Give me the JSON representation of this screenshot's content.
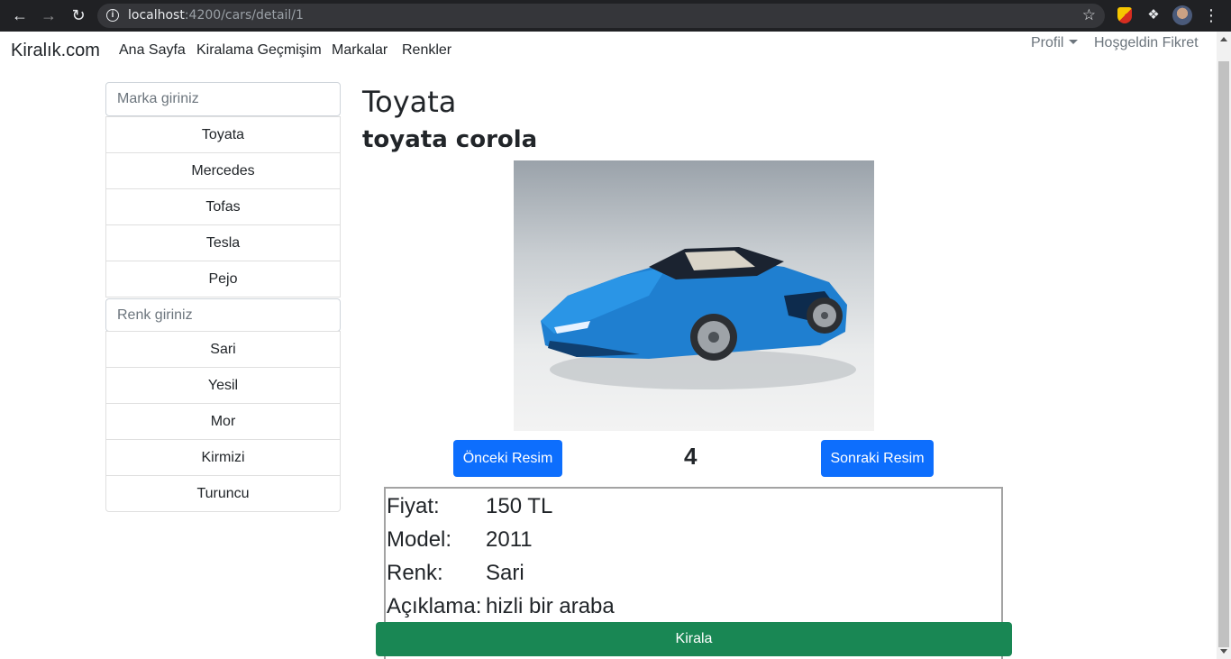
{
  "browser": {
    "url_host": "localhost",
    "url_path": ":4200/cars/detail/1"
  },
  "navbar": {
    "brand": "Kiralık.com",
    "links": [
      "Ana Sayfa",
      "Kiralama Geçmişim",
      "Markalar",
      "Renkler"
    ],
    "profile": "Profil",
    "greeting": "Hoşgeldin Fikret"
  },
  "sidebar": {
    "brand_placeholder": "Marka giriniz",
    "brands": [
      "Toyata",
      "Mercedes",
      "Tofas",
      "Tesla",
      "Pejo"
    ],
    "color_placeholder": "Renk giriniz",
    "colors": [
      "Sari",
      "Yesil",
      "Mor",
      "Kirmizi",
      "Turuncu"
    ]
  },
  "car": {
    "brand": "Toyata",
    "name": "toyata corola",
    "image_index": "4",
    "prev_label": "Önceki Resim",
    "next_label": "Sonraki Resim",
    "details": {
      "price_label": "Fiyat:",
      "price": "150 TL",
      "model_label": "Model:",
      "model": "2011",
      "color_label": "Renk:",
      "color": "Sari",
      "desc_label": "Açıklama:",
      "desc": "hizli bir araba"
    },
    "rent_label": "Kirala"
  },
  "colors": {
    "primary": "#0d6efd",
    "success": "#198754",
    "chrome": "#202124"
  }
}
